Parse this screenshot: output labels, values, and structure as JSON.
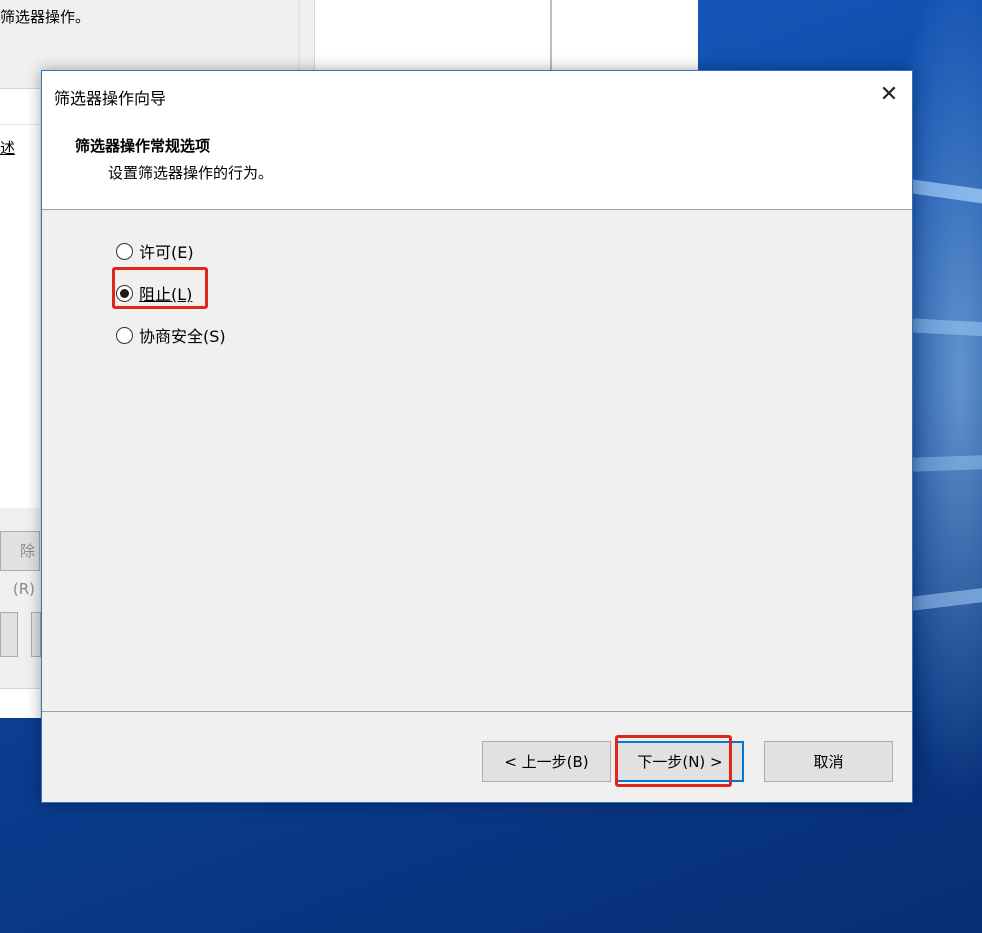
{
  "background_window": {
    "description_fragment": "筛选器操作。",
    "list_column_fragment": "述",
    "remove_button_fragment": "除(R)"
  },
  "dialog": {
    "title": "筛选器操作向导",
    "close_glyph": "✕",
    "header": {
      "title": "筛选器操作常规选项",
      "subtitle": "设置筛选器操作的行为。"
    },
    "options": [
      {
        "label": "许可(E)",
        "checked": false
      },
      {
        "label": "阻止(L)",
        "checked": true
      },
      {
        "label": "协商安全(S)",
        "checked": false
      }
    ],
    "buttons": {
      "back": "< 上一步(B)",
      "next": "下一步(N) >",
      "cancel": "取消"
    }
  },
  "colors": {
    "highlight": "#e0261b",
    "accent": "#0078d7"
  }
}
